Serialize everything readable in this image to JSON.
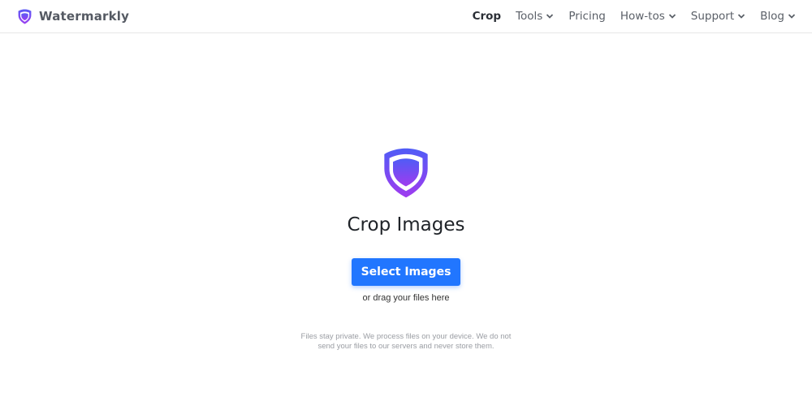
{
  "brand": {
    "name": "Watermarkly",
    "icon": "shield-icon"
  },
  "nav": [
    {
      "label": "Crop",
      "active": true,
      "dropdown": false
    },
    {
      "label": "Tools",
      "active": false,
      "dropdown": true
    },
    {
      "label": "Pricing",
      "active": false,
      "dropdown": false
    },
    {
      "label": "How-tos",
      "active": false,
      "dropdown": true
    },
    {
      "label": "Support",
      "active": false,
      "dropdown": true
    },
    {
      "label": "Blog",
      "active": false,
      "dropdown": true
    }
  ],
  "hero": {
    "icon": "shield-logo-icon",
    "title": "Crop Images",
    "button_label": "Select Images",
    "drag_text": "or drag your files here",
    "privacy_line1": "Files stay private. We process files on your device. We do not",
    "privacy_line2": "send your files to our servers and never store them."
  },
  "colors": {
    "accent": "#2176ff",
    "shield_top": "#5b5bf5",
    "shield_bottom": "#9b3df0"
  }
}
